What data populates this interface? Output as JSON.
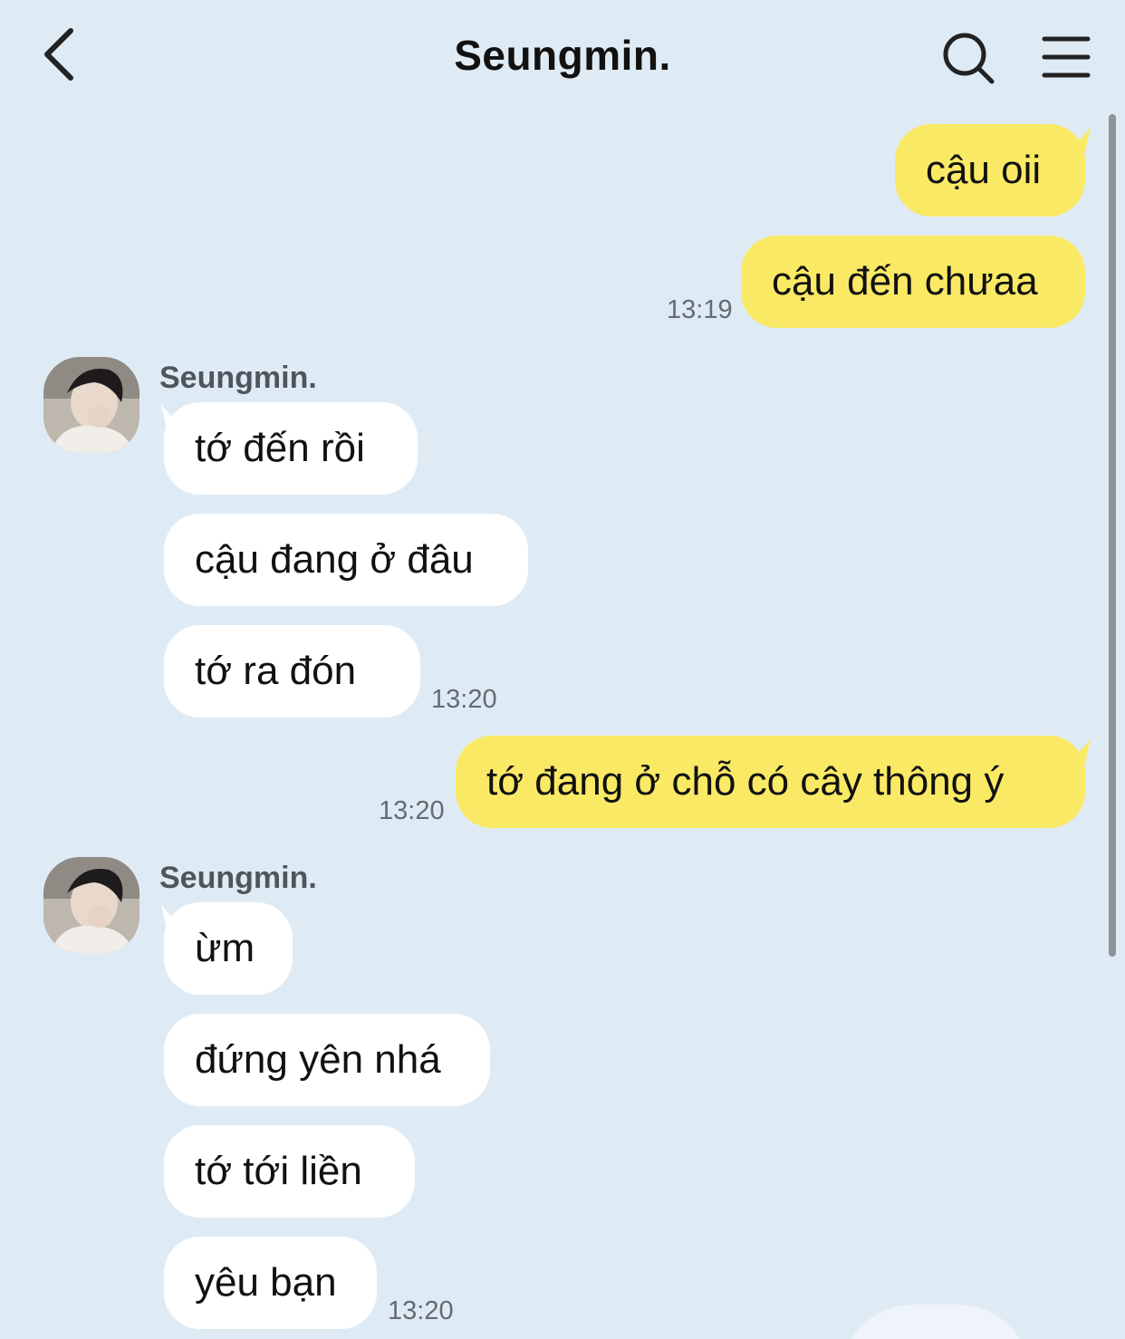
{
  "header": {
    "title": "Seungmin.",
    "back_icon": "chevron-left-icon",
    "search_icon": "search-icon",
    "menu_icon": "hamburger-menu-icon"
  },
  "colors": {
    "background": "#dfebf4",
    "my_bubble": "#fae965",
    "their_bubble": "#ffffff"
  },
  "messages": {
    "m1": {
      "text": "cậu oii"
    },
    "m2": {
      "text": "cậu đến chưaa",
      "time": "13:19"
    },
    "group1": {
      "sender": "Seungmin."
    },
    "m3": {
      "text": "tớ đến rồi"
    },
    "m4": {
      "text": "cậu đang ở đâu"
    },
    "m5": {
      "text": "tớ ra đón",
      "time": "13:20"
    },
    "m6": {
      "text": "tớ đang ở chỗ có cây thông ý",
      "time": "13:20"
    },
    "group2": {
      "sender": "Seungmin."
    },
    "m7": {
      "text": "ừm"
    },
    "m8": {
      "text": "đứng yên nhá"
    },
    "m9": {
      "text": "tớ tới liền"
    },
    "m10": {
      "text": "yêu bạn",
      "time": "13:20"
    }
  }
}
